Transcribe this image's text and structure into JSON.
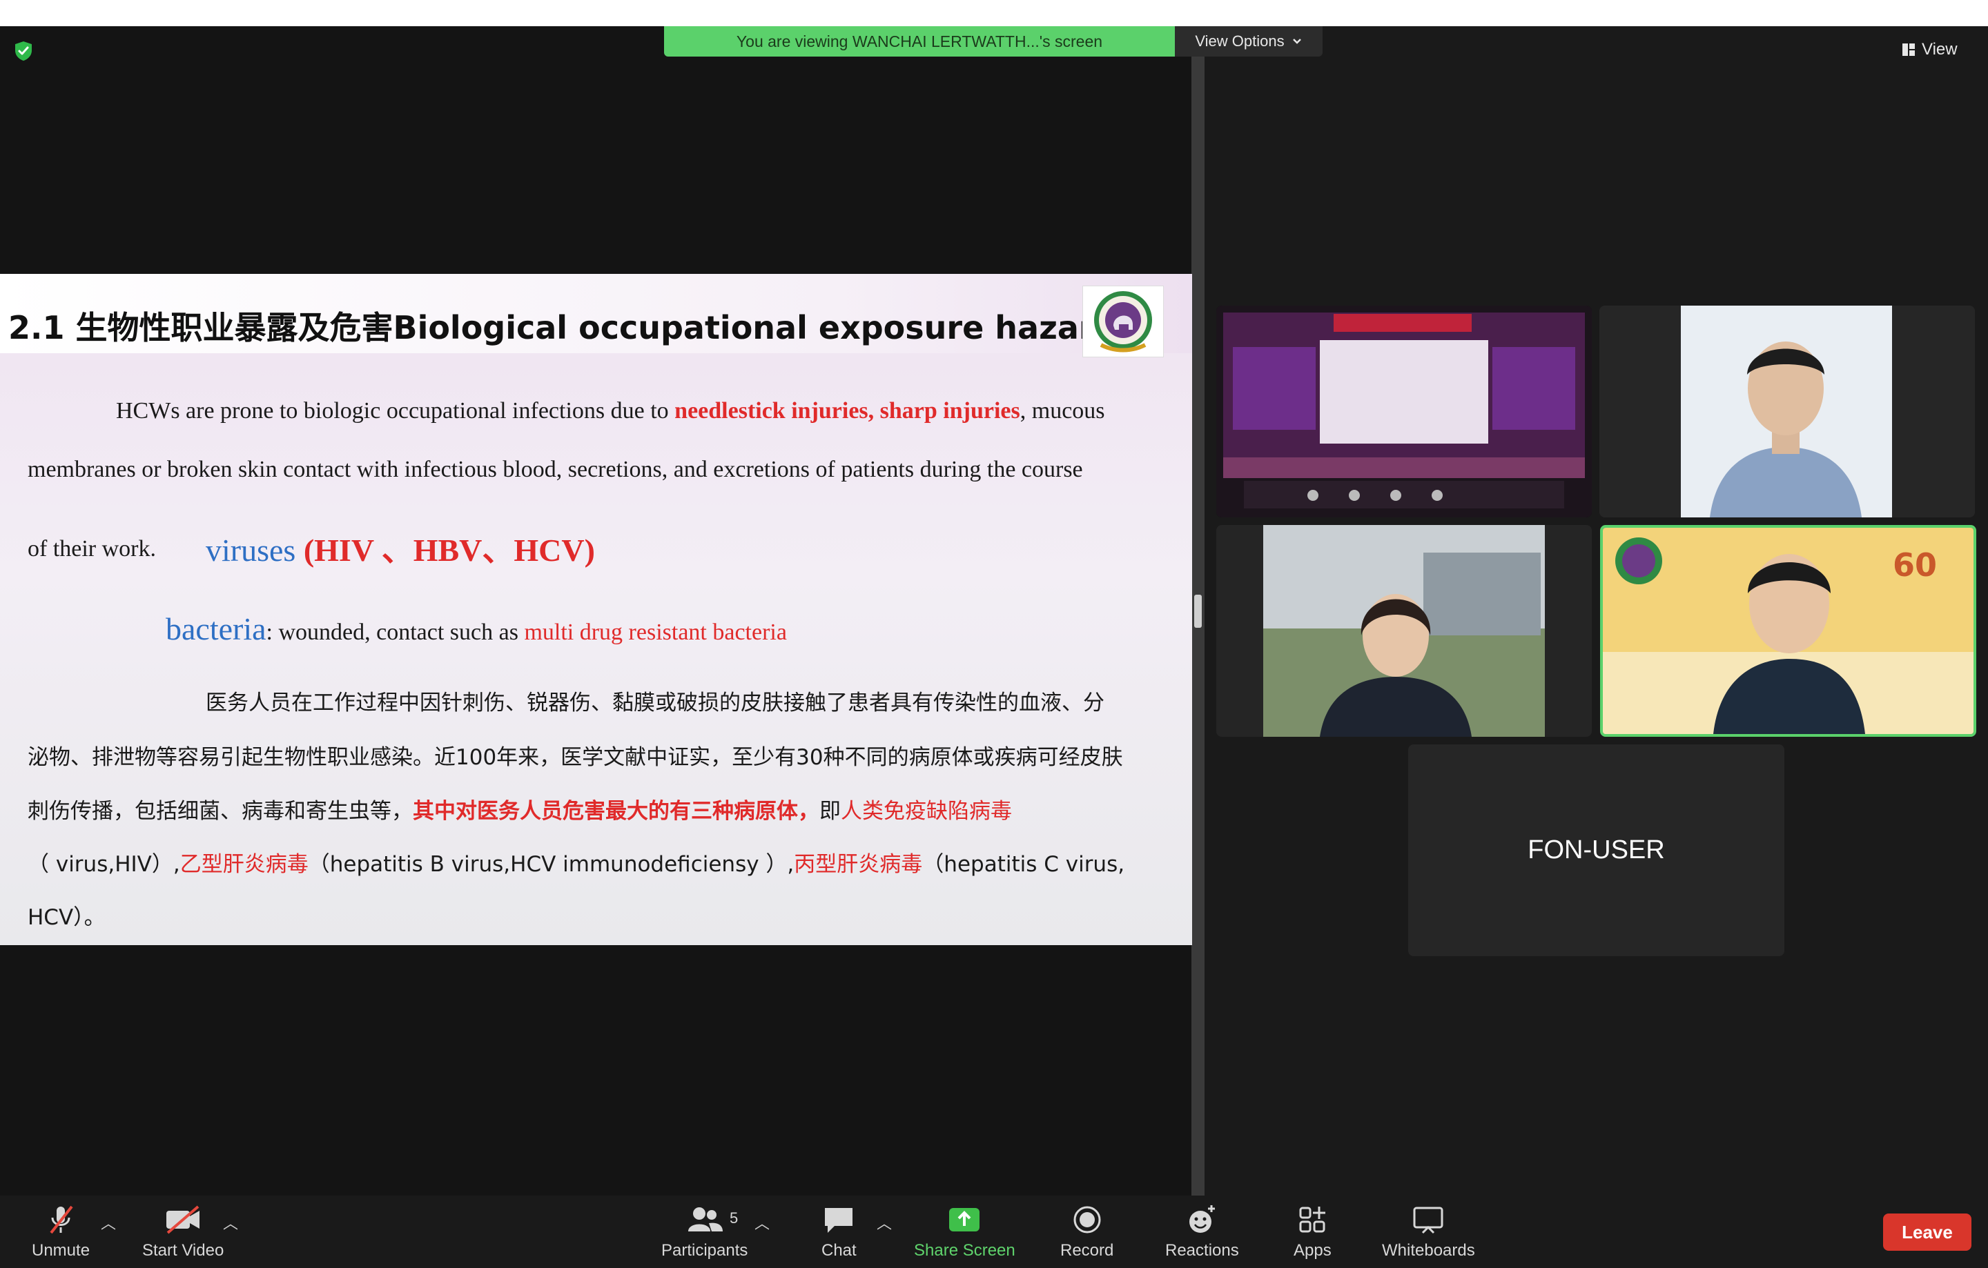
{
  "banner": {
    "viewing_text": "You are viewing WANCHAI LERTWATTH...'s screen",
    "view_options_label": "View Options"
  },
  "view_button": {
    "label": "View"
  },
  "slide": {
    "title": "2.1 生物性职业暴露及危害Biological occupational exposure hazards",
    "en_line1_a": "HCWs are prone to biologic occupational infections due to ",
    "en_line1_red": "needlestick injuries, sharp injuries",
    "en_line1_b": ", mucous",
    "en_line2": "membranes or broken skin contact with infectious blood, secretions, and excretions of patients during the course",
    "en_line3_a": "of their work.",
    "viruses_label": "viruses",
    "viruses_list": "(HIV 、HBV、HCV)",
    "bacteria_label": "bacteria",
    "bacteria_text": ": wounded, contact such as ",
    "bacteria_red": "multi drug resistant bacteria",
    "cn_line1": "医务人员在工作过程中因针刺伤、锐器伤、黏膜或破损的皮肤接触了患者具有传染性的血液、分",
    "cn_line2": "泌物、排泄物等容易引起生物性职业感染。近100年来，医学文献中证实，至少有30种不同的病原体或疾病可经皮肤",
    "cn_line3_a": "刺伤传播，包括细菌、病毒和寄生虫等，",
    "cn_line3_red_bold": "其中对医务人员危害最大的有三种病原体，",
    "cn_line3_b": "即",
    "cn_line3_red": "人类免疫缺陷病毒",
    "cn_line4_a": "（ virus,HIV）,",
    "cn_line4_red1": "乙型肝炎病毒",
    "cn_line4_b": "（hepatitis B virus,HCV immunodeficiensy ）,",
    "cn_line4_red2": "丙型肝炎病毒",
    "cn_line4_c": "（hepatitis C virus,",
    "cn_line5": "HCV）。"
  },
  "gallery": {
    "tile5_name": "FON-USER"
  },
  "toolbar": {
    "unmute": "Unmute",
    "start_video": "Start Video",
    "participants": "Participants",
    "participants_count": "5",
    "chat": "Chat",
    "share_screen": "Share Screen",
    "record": "Record",
    "reactions": "Reactions",
    "apps": "Apps",
    "whiteboards": "Whiteboards",
    "leave": "Leave"
  },
  "colors": {
    "banner_green": "#5bd16b",
    "leave_red": "#d9362b",
    "share_green": "#3fbf4a",
    "slide_red": "#e02a2a",
    "slide_blue": "#2e6fc4"
  }
}
